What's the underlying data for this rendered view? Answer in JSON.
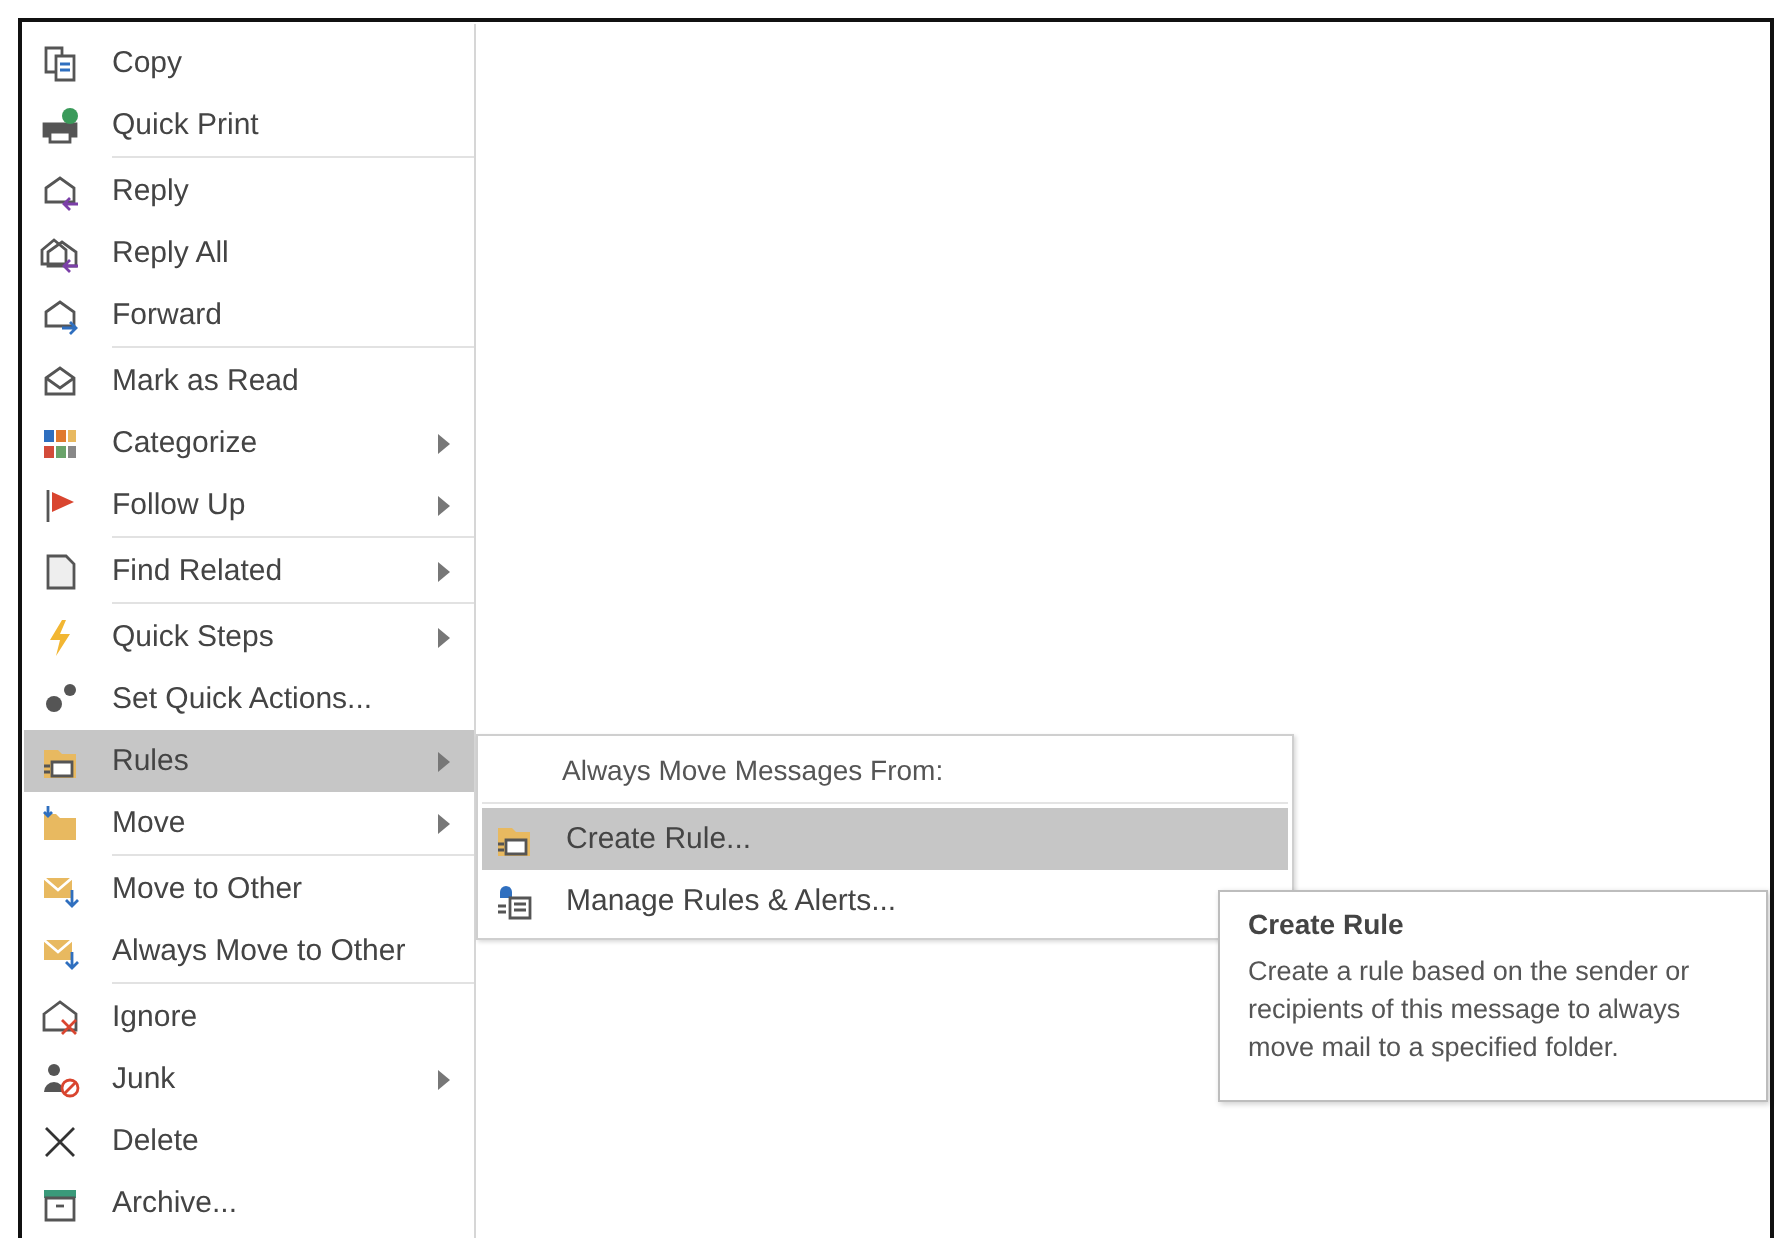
{
  "context_menu": {
    "groups": [
      {
        "items": [
          {
            "label": "Copy",
            "submenu": false,
            "selected": false
          },
          {
            "label": "Quick Print",
            "submenu": false,
            "selected": false
          }
        ]
      },
      {
        "items": [
          {
            "label": "Reply",
            "submenu": false,
            "selected": false
          },
          {
            "label": "Reply All",
            "submenu": false,
            "selected": false
          },
          {
            "label": "Forward",
            "submenu": false,
            "selected": false
          }
        ]
      },
      {
        "items": [
          {
            "label": "Mark as Read",
            "submenu": false,
            "selected": false
          },
          {
            "label": "Categorize",
            "submenu": true,
            "selected": false
          },
          {
            "label": "Follow Up",
            "submenu": true,
            "selected": false
          }
        ]
      },
      {
        "items": [
          {
            "label": "Find Related",
            "submenu": true,
            "selected": false
          }
        ]
      },
      {
        "items": [
          {
            "label": "Quick Steps",
            "submenu": true,
            "selected": false
          },
          {
            "label": "Set Quick Actions...",
            "submenu": false,
            "selected": false
          },
          {
            "label": "Rules",
            "submenu": true,
            "selected": true
          },
          {
            "label": "Move",
            "submenu": true,
            "selected": false
          }
        ]
      },
      {
        "items": [
          {
            "label": "Move to Other",
            "submenu": false,
            "selected": false
          },
          {
            "label": "Always Move to Other",
            "submenu": false,
            "selected": false
          }
        ]
      },
      {
        "items": [
          {
            "label": "Ignore",
            "submenu": false,
            "selected": false
          },
          {
            "label": "Junk",
            "submenu": true,
            "selected": false
          },
          {
            "label": "Delete",
            "submenu": false,
            "selected": false
          },
          {
            "label": "Archive...",
            "submenu": false,
            "selected": false
          }
        ]
      }
    ]
  },
  "submenu": {
    "header": "Always Move Messages From:",
    "items": [
      {
        "label": "Create Rule...",
        "selected": true
      },
      {
        "label": "Manage Rules & Alerts...",
        "selected": false
      }
    ]
  },
  "tooltip": {
    "title": "Create Rule",
    "body": "Create a rule based on the sender or recipients of this message to always move mail to a specified folder."
  }
}
